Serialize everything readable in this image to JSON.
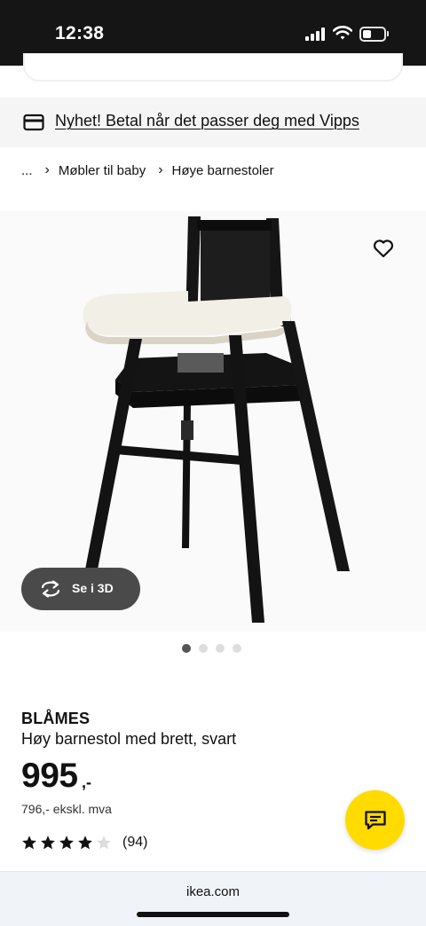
{
  "status_bar": {
    "time": "12:38",
    "icons": [
      "signal-icon",
      "wifi-icon",
      "battery-icon"
    ]
  },
  "banner": {
    "icon": "card-icon",
    "text": "Nyhet! Betal når det passer deg med Vipps"
  },
  "breadcrumb": {
    "items": [
      "...",
      "Møbler til baby",
      "Høye barnestoler"
    ]
  },
  "gallery": {
    "view_3d_label": "Se i 3D",
    "favorite_icon": "heart-icon",
    "rotate_icon": "rotate-icon",
    "slide_count": 4,
    "active_slide": 1
  },
  "product": {
    "name": "BLÅMES",
    "description": "Høy barnestol med brett, svart",
    "price": "995",
    "price_suffix": ",-",
    "price_ex_vat": "796,- ekskl. mva",
    "rating": 4,
    "rating_max": 5,
    "review_count": "(94)"
  },
  "chat": {
    "icon": "chat-icon"
  },
  "browser": {
    "url": "ikea.com"
  },
  "colors": {
    "accent_yellow": "#ffdb00",
    "status_bar": "#151515",
    "banner_bg": "#f5f5f5",
    "dark_pill": "#4a4a4a"
  }
}
